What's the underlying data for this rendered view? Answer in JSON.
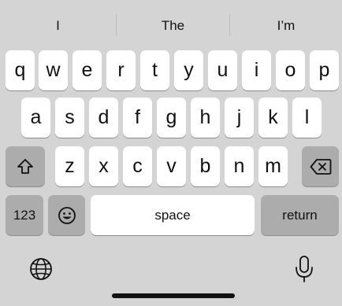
{
  "suggestions": [
    "I",
    "The",
    "I’m"
  ],
  "rows": [
    [
      "q",
      "w",
      "e",
      "r",
      "t",
      "y",
      "u",
      "i",
      "o",
      "p"
    ],
    [
      "a",
      "s",
      "d",
      "f",
      "g",
      "h",
      "j",
      "k",
      "l"
    ],
    [
      "z",
      "x",
      "c",
      "v",
      "b",
      "n",
      "m"
    ]
  ],
  "keys": {
    "numbers_label": "123",
    "space_label": "space",
    "return_label": "return"
  },
  "icons": {
    "shift": "shift-icon",
    "delete": "backspace-icon",
    "emoji": "emoji-icon",
    "globe": "globe-icon",
    "microphone": "microphone-icon"
  },
  "colors": {
    "background": "#d4d4d4",
    "letter_key": "#ffffff",
    "function_key": "#acacac",
    "text": "#111111"
  }
}
